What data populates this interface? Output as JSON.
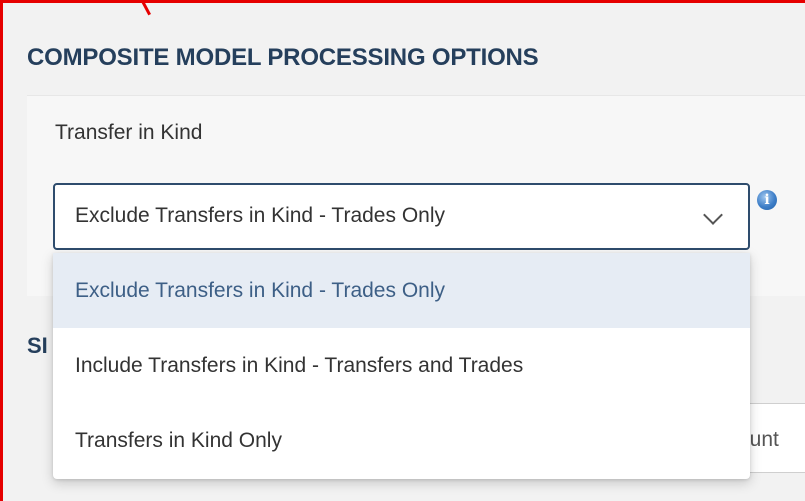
{
  "section": {
    "title": "COMPOSITE MODEL PROCESSING OPTIONS",
    "second_title_partial": "SI"
  },
  "transfer_field": {
    "label": "Transfer in Kind",
    "selected_value": "Exclude Transfers in Kind - Trades Only",
    "info_glyph": "i"
  },
  "dropdown": {
    "options": [
      {
        "label": "Exclude Transfers in Kind - Trades Only",
        "selected": true
      },
      {
        "label": "Include Transfers in Kind - Transfers and Trades",
        "selected": false
      },
      {
        "label": "Transfers in Kind Only",
        "selected": false
      }
    ]
  },
  "lower_field": {
    "partial_text": "ount"
  },
  "colors": {
    "accent": "#253f5c",
    "annotation_border": "#e60000",
    "selected_option_bg": "#e6ecf4"
  },
  "icons": [
    "chevron-down-icon",
    "info-icon"
  ]
}
